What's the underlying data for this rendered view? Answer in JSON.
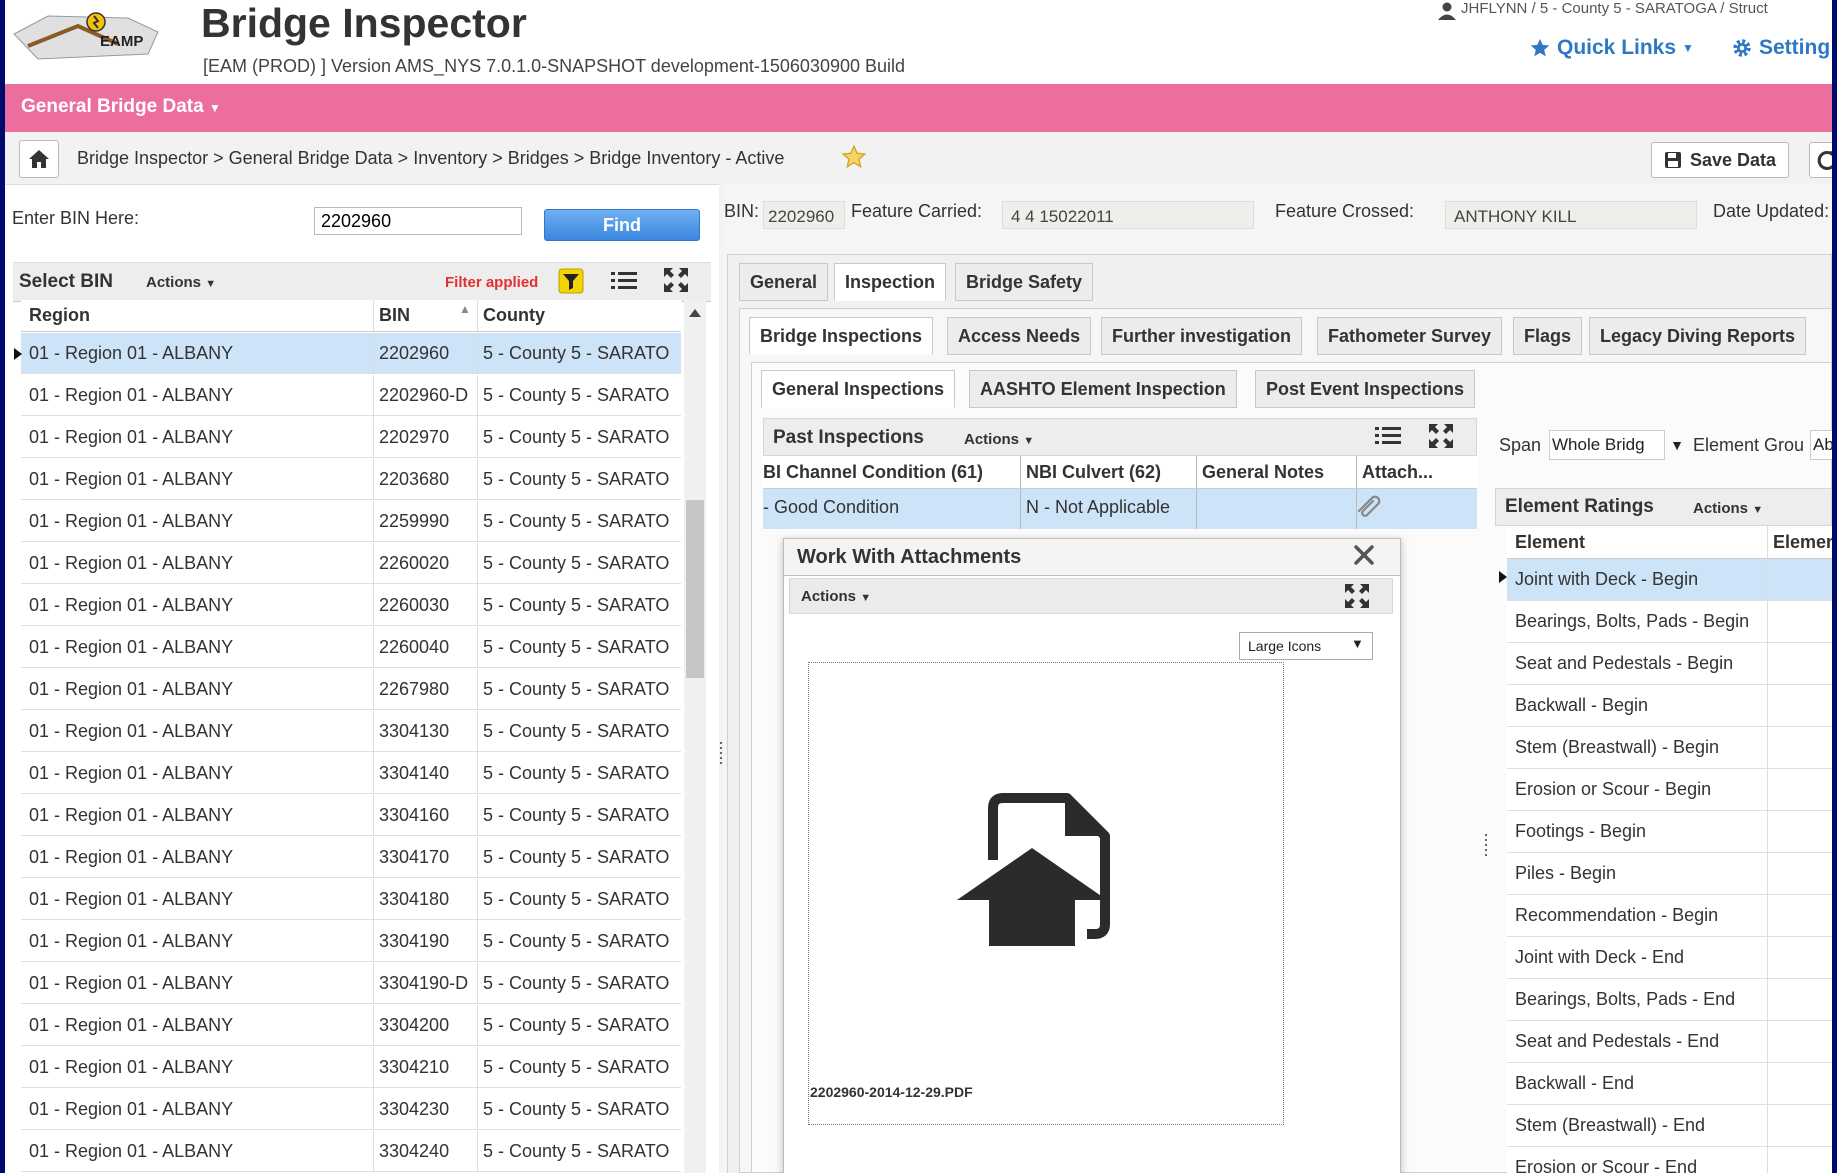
{
  "header": {
    "logo_text": "EAMP",
    "app_title": "Bridge Inspector",
    "version": "[EAM (PROD) ] Version AMS_NYS 7.0.1.0-SNAPSHOT development-1506030900 Build",
    "user": "JHFLYNN / 5 - County 5 - SARATOGA / Struct",
    "quick_links": "Quick Links",
    "settings": "Setting"
  },
  "menu": {
    "main": "General Bridge Data"
  },
  "breadcrumb": "Bridge Inspector > General Bridge Data > Inventory > Bridges > Bridge Inventory - Active",
  "toolbar": {
    "save": "Save Data"
  },
  "left": {
    "bin_label": "Enter BIN Here:",
    "bin_value": "2202960",
    "find": "Find",
    "panel_title": "Select BIN",
    "actions": "Actions",
    "filter": "Filter applied",
    "columns": [
      "Region",
      "BIN",
      "County"
    ],
    "rows": [
      [
        "01 - Region 01 - ALBANY",
        "2202960",
        "5 - County 5 - SARATO"
      ],
      [
        "01 - Region 01 - ALBANY",
        "2202960-D",
        "5 - County 5 - SARATO"
      ],
      [
        "01 - Region 01 - ALBANY",
        "2202970",
        "5 - County 5 - SARATO"
      ],
      [
        "01 - Region 01 - ALBANY",
        "2203680",
        "5 - County 5 - SARATO"
      ],
      [
        "01 - Region 01 - ALBANY",
        "2259990",
        "5 - County 5 - SARATO"
      ],
      [
        "01 - Region 01 - ALBANY",
        "2260020",
        "5 - County 5 - SARATO"
      ],
      [
        "01 - Region 01 - ALBANY",
        "2260030",
        "5 - County 5 - SARATO"
      ],
      [
        "01 - Region 01 - ALBANY",
        "2260040",
        "5 - County 5 - SARATO"
      ],
      [
        "01 - Region 01 - ALBANY",
        "2267980",
        "5 - County 5 - SARATO"
      ],
      [
        "01 - Region 01 - ALBANY",
        "3304130",
        "5 - County 5 - SARATO"
      ],
      [
        "01 - Region 01 - ALBANY",
        "3304140",
        "5 - County 5 - SARATO"
      ],
      [
        "01 - Region 01 - ALBANY",
        "3304160",
        "5 - County 5 - SARATO"
      ],
      [
        "01 - Region 01 - ALBANY",
        "3304170",
        "5 - County 5 - SARATO"
      ],
      [
        "01 - Region 01 - ALBANY",
        "3304180",
        "5 - County 5 - SARATO"
      ],
      [
        "01 - Region 01 - ALBANY",
        "3304190",
        "5 - County 5 - SARATO"
      ],
      [
        "01 - Region 01 - ALBANY",
        "3304190-D",
        "5 - County 5 - SARATO"
      ],
      [
        "01 - Region 01 - ALBANY",
        "3304200",
        "5 - County 5 - SARATO"
      ],
      [
        "01 - Region 01 - ALBANY",
        "3304210",
        "5 - County 5 - SARATO"
      ],
      [
        "01 - Region 01 - ALBANY",
        "3304230",
        "5 - County 5 - SARATO"
      ],
      [
        "01 - Region 01 - ALBANY",
        "3304240",
        "5 - County 5 - SARATO"
      ]
    ]
  },
  "right": {
    "bin_label": "BIN:",
    "bin_value": "2202960",
    "feature_carried_label": "Feature Carried:",
    "feature_carried_value": "4   4 15022011",
    "feature_crossed_label": "Feature Crossed:",
    "feature_crossed_value": "ANTHONY KILL",
    "date_updated_label": "Date Updated:",
    "tabs1": [
      "General",
      "Inspection",
      "Bridge Safety"
    ],
    "tabs2": [
      "Bridge Inspections",
      "Access Needs",
      "Further investigation",
      "Fathometer Survey",
      "Flags",
      "Legacy Diving Reports"
    ],
    "tabs3": [
      "General Inspections",
      "AASHTO Element Inspection",
      "Post Event Inspections"
    ],
    "past": {
      "title": "Past Inspections",
      "actions": "Actions",
      "columns": [
        "BI Channel Condition (61)",
        "NBI Culvert (62)",
        "General Notes",
        "Attach..."
      ],
      "row": [
        "- Good Condition",
        "N - Not Applicable",
        ""
      ]
    },
    "span_label": "Span",
    "span_value": "Whole Bridg",
    "element_group_label": "Element Grou",
    "element_group_value": "Ab",
    "element_ratings": {
      "title": "Element Ratings",
      "actions": "Actions",
      "columns": [
        "Element",
        "Elemen"
      ],
      "rows": [
        "Joint with Deck - Begin",
        "Bearings, Bolts, Pads - Begin",
        "Seat and Pedestals - Begin",
        "Backwall - Begin",
        "Stem (Breastwall) - Begin",
        "Erosion or Scour - Begin",
        "Footings - Begin",
        "Piles - Begin",
        "Recommendation - Begin",
        "Joint with Deck - End",
        "Bearings, Bolts, Pads - End",
        "Seat and Pedestals - End",
        "Backwall - End",
        "Stem (Breastwall) - End",
        "Erosion or Scour - End"
      ]
    }
  },
  "modal": {
    "title": "Work With Attachments",
    "actions": "Actions",
    "view": "Large Icons",
    "file_name": "2202960-2014-12-29.PDF"
  },
  "colors": {
    "accent_pink": "#ec6e9e",
    "link_blue": "#2f78c4",
    "selection": "#cde3f7",
    "frame": "#000a6e"
  }
}
